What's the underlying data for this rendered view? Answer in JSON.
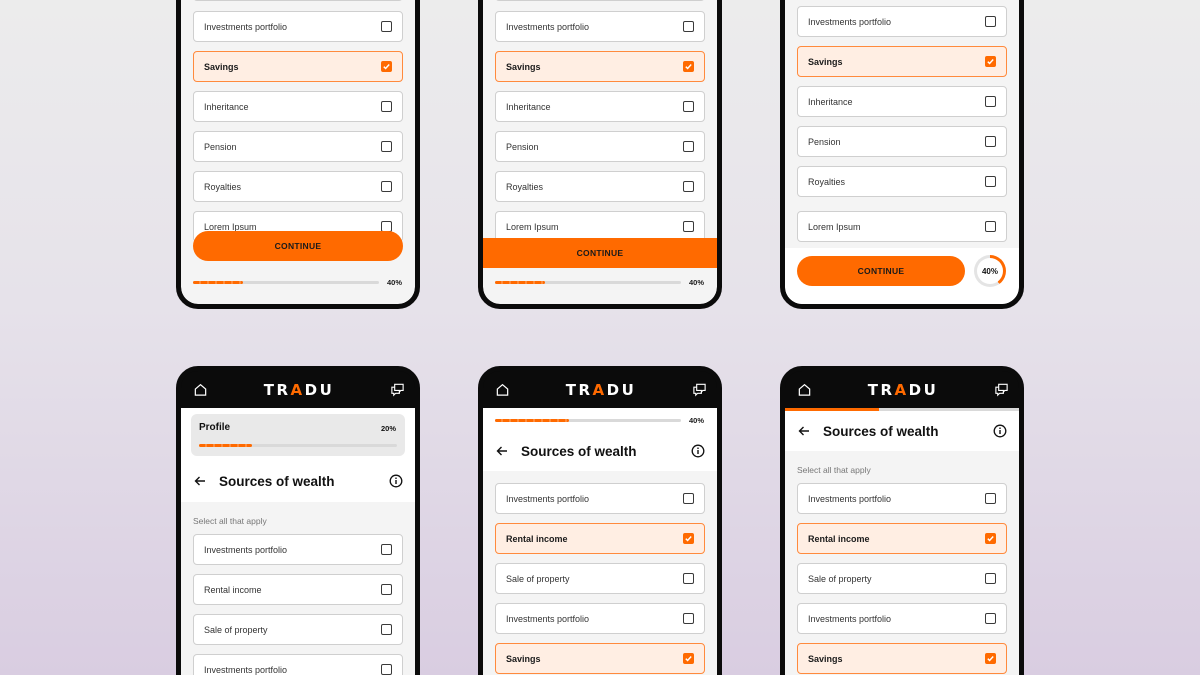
{
  "brand": {
    "logo_pre": "TR",
    "logo_accent": "A",
    "logo_post": "DU",
    "accent_color": "#ff6a00"
  },
  "common": {
    "title": "Sources of wealth",
    "subtitle": "Select all that apply",
    "continue_label": "CONTINUE"
  },
  "screen1": {
    "options": [
      "Investments portfolio",
      "Savings",
      "Inheritance",
      "Pension",
      "Royalties",
      "Lorem Ipsum"
    ],
    "progress_label": "40%",
    "progress_value": 0.27
  },
  "screen2": {
    "options": [
      "Investments portfolio",
      "Savings",
      "Inheritance",
      "Pension",
      "Royalties",
      "Lorem Ipsum"
    ],
    "progress_label": "40%",
    "progress_value": 0.27
  },
  "screen3": {
    "options": [
      "Investments portfolio",
      "Savings",
      "Inheritance",
      "Pension",
      "Royalties",
      "Lorem Ipsum"
    ],
    "progress_label": "40%",
    "progress_value": 0.4
  },
  "screen4": {
    "profile_label": "Profile",
    "profile_pct": "20%",
    "progress_value": 0.27,
    "options": [
      "Investments portfolio",
      "Rental income",
      "Sale of property",
      "Investments portfolio"
    ]
  },
  "screen5": {
    "progress_label": "40%",
    "progress_value": 0.4,
    "options": [
      "Investments portfolio",
      "Rental income",
      "Sale of property",
      "Investments portfolio",
      "Savings"
    ]
  },
  "screen6": {
    "progress_value": 0.4,
    "options": [
      "Investments portfolio",
      "Rental income",
      "Sale of property",
      "Investments portfolio",
      "Savings"
    ]
  }
}
